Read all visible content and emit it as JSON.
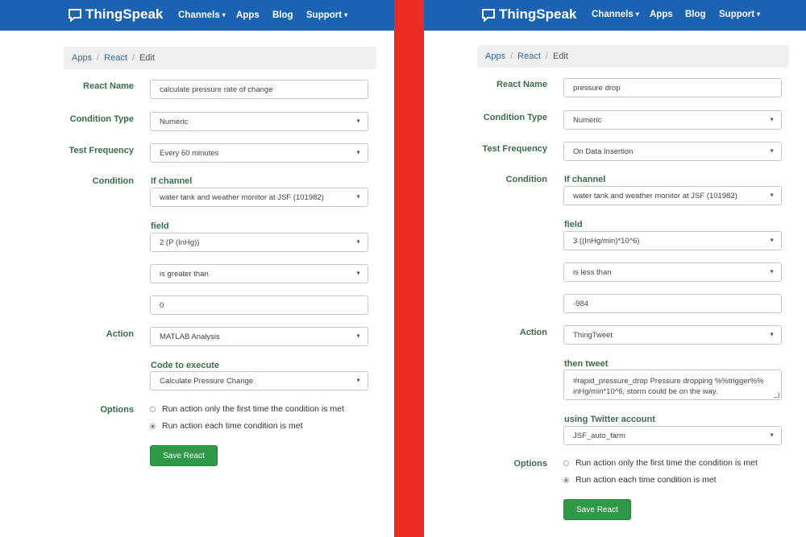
{
  "nav": {
    "brand": "ThingSpeak",
    "channels": "Channels",
    "apps": "Apps",
    "blog": "Blog",
    "support": "Support"
  },
  "breadcrumb": {
    "apps": "Apps",
    "react": "React",
    "edit": "Edit"
  },
  "labels": {
    "react_name": "React Name",
    "condition_type": "Condition Type",
    "test_frequency": "Test Frequency",
    "condition": "Condition",
    "if_channel": "If channel",
    "field": "field",
    "action": "Action",
    "code_to_execute": "Code to execute",
    "then_tweet": "then tweet",
    "using_twitter_account": "using Twitter account",
    "options": "Options"
  },
  "options": {
    "first_time": "Run action only the first time the condition is met",
    "each_time": "Run action each time condition is met"
  },
  "save_button": "Save React",
  "left": {
    "react_name": "calculate pressure rate of change",
    "condition_type": "Numeric",
    "test_frequency": "Every 60 minutes",
    "channel": "water tank and weather monitor at JSF (101982)",
    "field": "2 (P (InHg))",
    "operator": "is greater than",
    "value": "0",
    "action": "MATLAB Analysis",
    "code": "Calculate Pressure Change"
  },
  "right": {
    "react_name": "pressure drop",
    "condition_type": "Numeric",
    "test_frequency": "On Data Insertion",
    "channel": "water tank and weather monitor at JSF (101982)",
    "field": "3 ((InHg/min)*10^6)",
    "operator": "is less than",
    "value": "-984",
    "action": "ThingTweet",
    "tweet": "#rapid_pressure_drop Pressure dropping %%trigger%% inHg/min*10^6, storm could be on the way.",
    "twitter_account": "JSF_auto_farm"
  },
  "colors": {
    "navbar": "#1b62b3",
    "divider": "#ea2b23",
    "button": "#2e9a48",
    "label": "#3d6b4a"
  }
}
